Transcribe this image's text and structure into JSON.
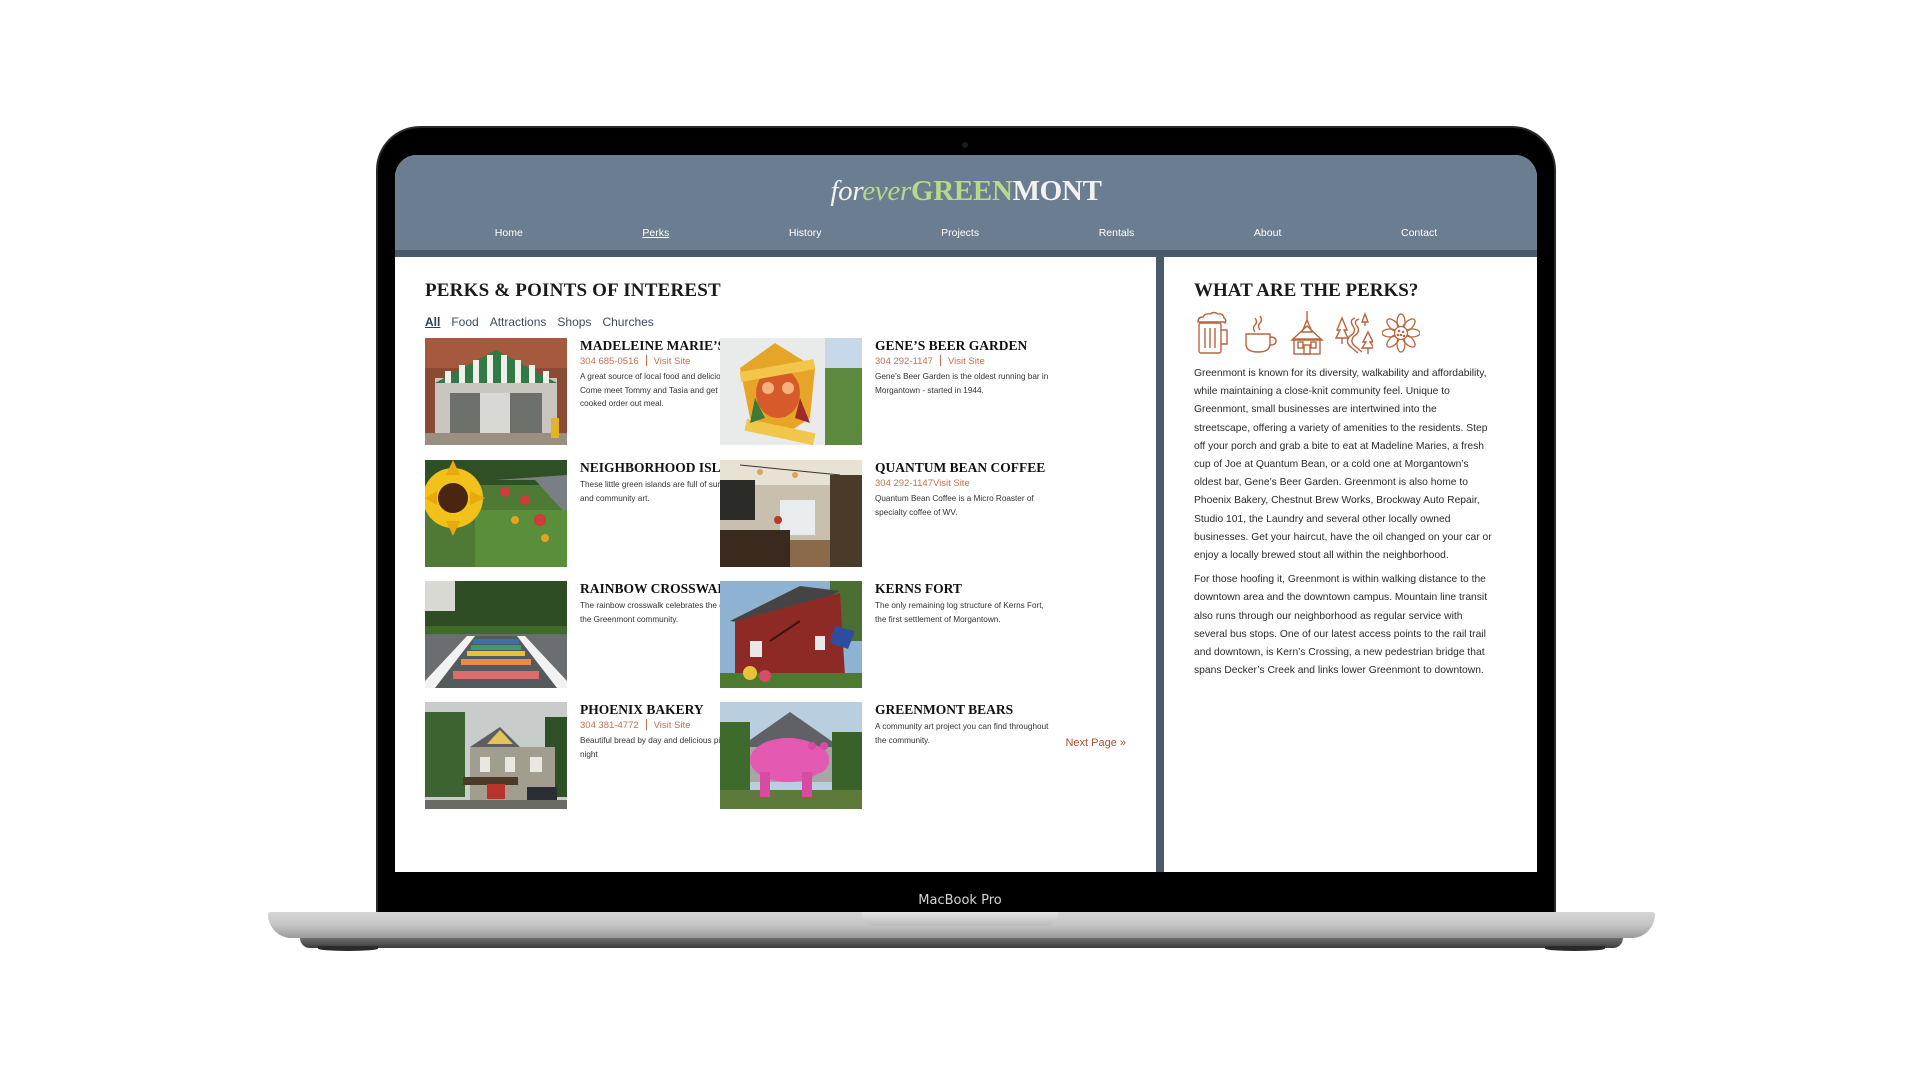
{
  "device": {
    "label": "MacBook Pro"
  },
  "site": {
    "logo": {
      "part1": "for",
      "part2": "ever",
      "part3": "GREEN",
      "part4": "MONT"
    },
    "nav": [
      {
        "label": "Home",
        "active": false
      },
      {
        "label": "Perks",
        "active": true
      },
      {
        "label": "History",
        "active": false
      },
      {
        "label": "Projects",
        "active": false
      },
      {
        "label": "Rentals",
        "active": false
      },
      {
        "label": "About",
        "active": false
      },
      {
        "label": "Contact",
        "active": false
      }
    ],
    "colors": {
      "header": "#6b7d90",
      "header_dark": "#4a5a6b",
      "logo_green": "#b5d98a",
      "accent": "#c0714f",
      "next_link": "#a8502f"
    }
  },
  "main": {
    "title": "PERKS & POINTS OF INTEREST",
    "filters": [
      {
        "label": "All",
        "active": true
      },
      {
        "label": "Food",
        "active": false
      },
      {
        "label": "Attractions",
        "active": false
      },
      {
        "label": "Shops",
        "active": false
      },
      {
        "label": "Churches",
        "active": false
      }
    ],
    "perks": [
      {
        "name": "MADELEINE MARIE’S",
        "phone": "304 685-0516",
        "link": "Visit Site",
        "desc": "A great source of local food and delicious flavors. Come meet Tommy and Tasia and get a fresh cooked order out meal.",
        "image": "storefront with green striped awning"
      },
      {
        "name": "GENE’S BEER GARDEN",
        "phone": "304 292-1147",
        "link": "Visit Site",
        "desc": "Gene’s Beer Garden is the oldest running bar in Morgantown - started in 1944.",
        "image": "Gene's Beer Garden mural"
      },
      {
        "name": "NEIGHBORHOOD ISLANDS",
        "phone": "",
        "link": "",
        "desc": "These little green islands are full of sunflowers and community art.",
        "image": "sunflower in green island"
      },
      {
        "name": "QUANTUM BEAN COFFEE",
        "phone": "304 292-1147",
        "link": "Visit Site",
        "desc": "Quantum Bean Coffee is a Micro Roaster of specialty coffee of WV.",
        "image": "coffee shop interior"
      },
      {
        "name": "RAINBOW CROSSWALK",
        "phone": "",
        "link": "",
        "desc": "The rainbow crosswalk celebrates the diversity of the Greenmont community.",
        "image": "rainbow crosswalk"
      },
      {
        "name": "KERNS FORT",
        "phone": "",
        "link": "",
        "desc": "The only remaining log structure of Kerns Fort, the first settlement of Morgantown.",
        "image": "red log house"
      },
      {
        "name": "PHOENIX BAKERY",
        "phone": "304 381-4772",
        "link": "Visit Site",
        "desc": "Beautiful bread by day and delicious pizzas by night",
        "image": "victorian house bakery"
      },
      {
        "name": "GREENMONT BEARS",
        "phone": "",
        "link": "",
        "desc": "A community art project you can find throughout the community.",
        "image": "pink bear statue"
      }
    ],
    "next_page": "Next Page »"
  },
  "sidebar": {
    "title": "WHAT ARE THE PERKS?",
    "icons": [
      "beer-mug-icon",
      "coffee-cup-icon",
      "church-icon",
      "trail-trees-icon",
      "sunflower-icon"
    ],
    "paragraphs": [
      "Greenmont is known for its diversity, walkability and affordability, while maintaining a close-knit community feel. Unique to Greenmont, small businesses are intertwined into the streetscape, offering a variety of amenities to the residents. Step off your porch and grab a bite to eat at Madeline Maries, a fresh cup of Joe at Quantum Bean, or a cold one at Morgantown’s oldest bar, Gene’s Beer Garden. Greenmont is also home to Phoenix Bakery, Chestnut Brew Works, Brockway Auto Repair, Studio 101, the Laundry and several other locally owned businesses. Get your haircut, have the oil changed on your car or enjoy a locally brewed stout all within the neighborhood.",
      "For those hoofing it, Greenmont is within walking distance to the downtown area and the downtown campus. Mountain line transit also runs through our neighborhood as regular service with several bus stops. One of our latest access points to the rail trail and downtown, is Kern’s Crossing, a new pedestrian bridge that spans Decker’s Creek and links lower Greenmont to downtown."
    ]
  }
}
